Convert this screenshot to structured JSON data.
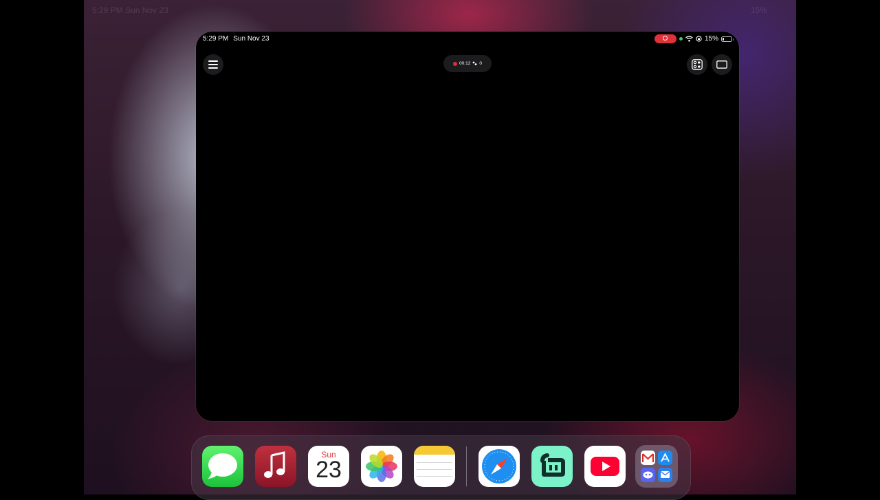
{
  "background_status": {
    "time": "5:29 PM",
    "date": "Sun Nov 23",
    "battery": "15%"
  },
  "status_bar": {
    "time": "5:29 PM",
    "date": "Sun Nov 23",
    "battery": "15%"
  },
  "recording": {
    "timer": "00:12",
    "count": "0"
  },
  "toolbar": {
    "menu_icon": "hamburger-menu-icon",
    "controls_icon": "controls-icon",
    "screen_icon": "screen-rectangle-icon"
  },
  "calendar": {
    "day": "Sun",
    "date": "23"
  },
  "dock": {
    "apps": [
      "Messages",
      "Music",
      "Calendar",
      "Photos",
      "Notes",
      "Safari",
      "Streamlabs",
      "YouTube",
      "Folder"
    ]
  },
  "colors": {
    "record_red": "#e0303a",
    "messages_green": "#1cc23a",
    "youtube_red": "#ff0033",
    "streamlabs_mint": "#7cf2c9"
  }
}
